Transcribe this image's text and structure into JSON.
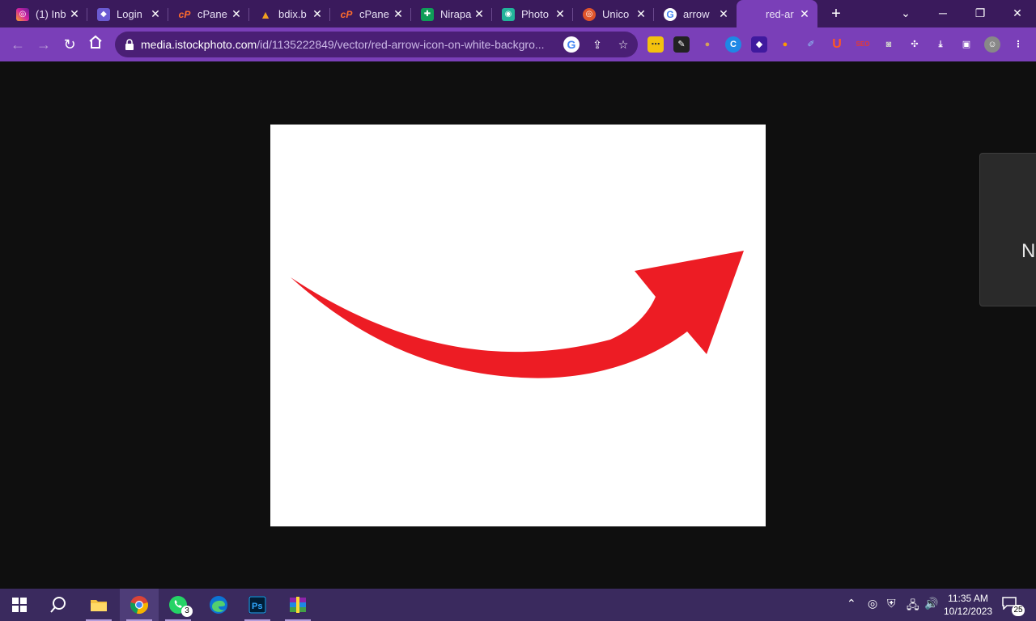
{
  "tabs": [
    {
      "title": "(1) Inb",
      "icon": "instagram-icon",
      "color": "#d6249f"
    },
    {
      "title": "Login",
      "icon": "shield-icon",
      "color": "#6b5bd2"
    },
    {
      "title": "cPane",
      "icon": "cpanel-icon",
      "color": "#ff6c2c"
    },
    {
      "title": "bdix.b",
      "icon": "bdix-icon",
      "color": "#f0a020"
    },
    {
      "title": "cPane",
      "icon": "cpanel-icon",
      "color": "#ff6c2c"
    },
    {
      "title": "Nirapa",
      "icon": "nirapad-icon",
      "color": "#0f9d58"
    },
    {
      "title": "Photo",
      "icon": "photo-icon",
      "color": "#22b39a"
    },
    {
      "title": "Unico",
      "icon": "unicorn-icon",
      "color": "#e0542a"
    },
    {
      "title": "arrow",
      "icon": "google-icon",
      "color": "#ffffff"
    }
  ],
  "active_tab": {
    "title": "red-ar"
  },
  "address_bar": {
    "domain": "media.istockphoto.com",
    "path": "/id/1135222849/vector/red-arrow-icon-on-white-backgro..."
  },
  "page": {
    "arrow_color": "#ed1c24",
    "side_card_text": "N"
  },
  "taskbar": {
    "whatsapp_badge": "3",
    "time": "11:35 AM",
    "date": "10/12/2023",
    "notification_count": "25"
  },
  "colors": {
    "tab_strip": "#3a1a5c",
    "toolbar": "#7a3fb8",
    "taskbar": "#3a2a5e"
  }
}
